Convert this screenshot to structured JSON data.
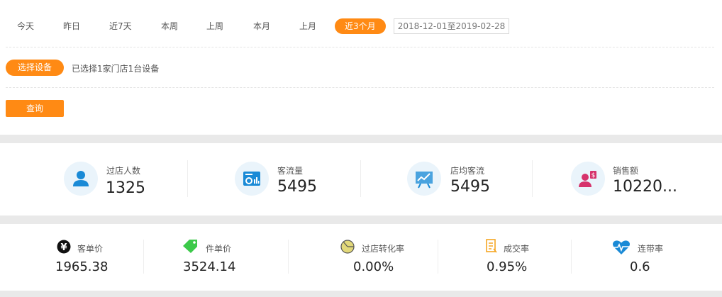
{
  "filters": {
    "tabs": [
      "今天",
      "昨日",
      "近7天",
      "本周",
      "上周",
      "本月",
      "上月",
      "近3个月"
    ],
    "active_tab": "近3个月",
    "date_range": "2018-12-01至2019-02-28"
  },
  "device": {
    "select_label": "选择设备",
    "info": "已选择1家门店1台设备"
  },
  "query_label": "查询",
  "colors": {
    "accent": "#ff8a14",
    "icon_blue": "#1a8ad6",
    "icon_pink": "#d6336c",
    "icon_green": "#3cc94a"
  },
  "stats": [
    {
      "label": "过店人数",
      "value": "1325",
      "icon": "person-icon"
    },
    {
      "label": "客流量",
      "value": "5495",
      "icon": "traffic-chart-icon"
    },
    {
      "label": "店均客流",
      "value": "5495",
      "icon": "presentation-chart-icon"
    },
    {
      "label": "销售额",
      "value": "10220...",
      "icon": "sales-person-icon"
    }
  ],
  "kpis": [
    {
      "label": "客单价",
      "value": "1965.38",
      "icon": "yen-icon"
    },
    {
      "label": "件单价",
      "value": "3524.14",
      "icon": "price-tag-icon"
    },
    {
      "label": "过店转化率",
      "value": "0.00%",
      "icon": "pie-chart-icon"
    },
    {
      "label": "成交率",
      "value": "0.95%",
      "icon": "document-icon"
    },
    {
      "label": "连带率",
      "value": "0.6",
      "icon": "heartbeat-icon"
    }
  ]
}
